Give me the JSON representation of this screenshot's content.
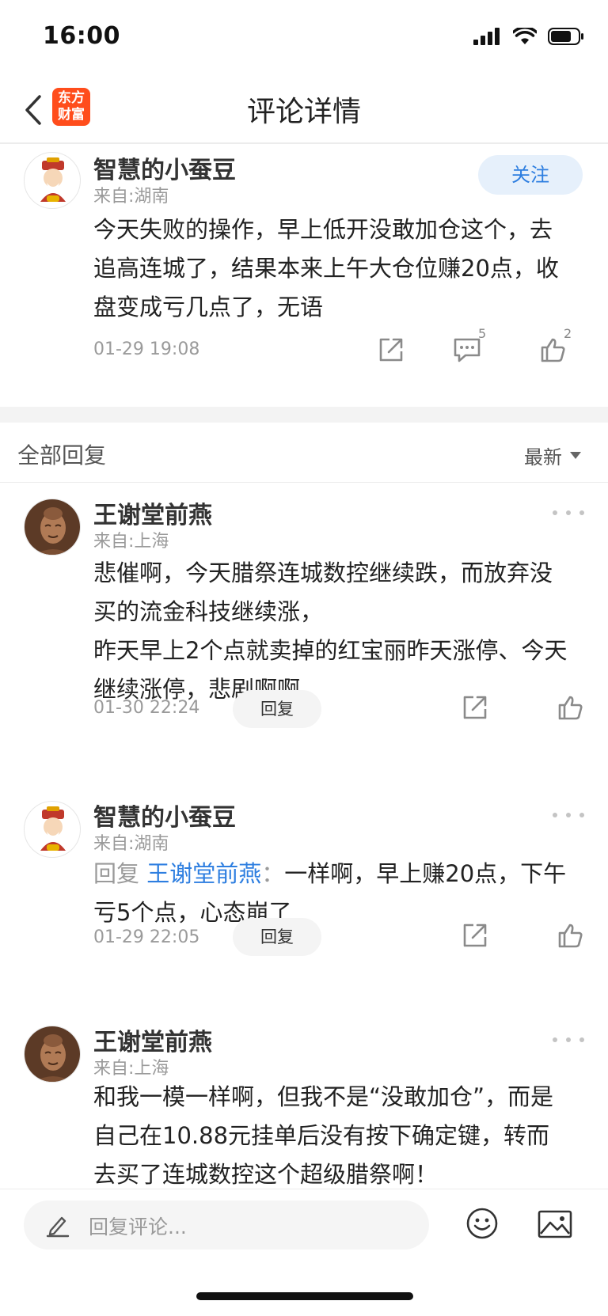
{
  "status_bar": {
    "time": "16:00"
  },
  "nav": {
    "title": "评论详情",
    "logo_line1": "东方",
    "logo_line2": "财富"
  },
  "main_comment": {
    "username": "智慧的小蚕豆",
    "location": "来自:湖南",
    "follow_label": "关注",
    "content": "今天失败的操作，早上低开没敢加仓这个，去追高连城了，结果本来上午大仓位赚20点，收盘变成亏几点了，无语",
    "time": "01-29 19:08",
    "comment_count": "5",
    "like_count": "2"
  },
  "replies_header": {
    "title": "全部回复",
    "sort_label": "最新"
  },
  "replies": [
    {
      "username": "王谢堂前燕",
      "location": "来自:上海",
      "content": "悲催啊，今天腊祭连城数控继续跌，而放弃没买的流金科技继续涨，\n昨天早上2个点就卖掉的红宝丽昨天涨停、今天继续涨停，悲剧啊啊",
      "time": "01-30 22:24",
      "reply_label": "回复"
    },
    {
      "username": "智慧的小蚕豆",
      "location": "来自:湖南",
      "reply_prefix": "回复 ",
      "reply_target": "王谢堂前燕",
      "reply_colon": "：",
      "content": "一样啊，早上赚20点，下午亏5个点，心态崩了",
      "time": "01-29 22:05",
      "reply_label": "回复"
    },
    {
      "username": "王谢堂前燕",
      "location": "来自:上海",
      "content": "和我一模一样啊，但我不是“没敢加仓”，而是自己在10.88元挂单后没有按下确定键，转而去买了连城数控这个超级腊祭啊！"
    }
  ],
  "input_bar": {
    "placeholder": "回复评论..."
  },
  "colors": {
    "accent": "#2d7ee0",
    "brand": "#ff4d1c",
    "follow_bg": "#e6f0fb"
  }
}
